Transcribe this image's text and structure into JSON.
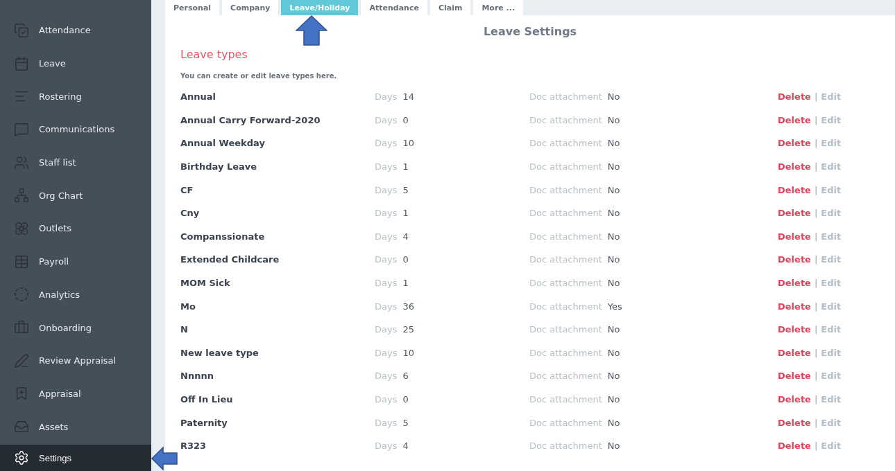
{
  "sidebar": {
    "items": [
      {
        "label": "Attendance",
        "selected": false
      },
      {
        "label": "Leave",
        "selected": false
      },
      {
        "label": "Rostering",
        "selected": false
      },
      {
        "label": "Communications",
        "selected": false
      },
      {
        "label": "Staff list",
        "selected": false
      },
      {
        "label": "Org Chart",
        "selected": false
      },
      {
        "label": "Outlets",
        "selected": false
      },
      {
        "label": "Payroll",
        "selected": false
      },
      {
        "label": "Analytics",
        "selected": false
      },
      {
        "label": "Onboarding",
        "selected": false
      },
      {
        "label": "Review Appraisal",
        "selected": false
      },
      {
        "label": "Appraisal",
        "selected": false
      },
      {
        "label": "Assets",
        "selected": false
      },
      {
        "label": "Settings",
        "selected": true
      }
    ]
  },
  "tabs": [
    {
      "label": "Personal",
      "selected": false
    },
    {
      "label": "Company",
      "selected": false
    },
    {
      "label": "Leave/Holiday",
      "selected": true
    },
    {
      "label": "Attendance",
      "selected": false
    },
    {
      "label": "Claim",
      "selected": false
    },
    {
      "label": "More ...",
      "selected": false
    }
  ],
  "page_title": "Leave Settings",
  "section_title": "Leave types",
  "section_hint": "You can create or edit leave types here.",
  "leave_types": [
    {
      "name": "Annual",
      "days_label": "Days",
      "days": "14",
      "doc_label": "Doc attachment",
      "doc": "No",
      "delete": "Delete",
      "separator": "|",
      "edit": "Edit"
    },
    {
      "name": "Annual Carry Forward-2020",
      "days_label": "Days",
      "days": "0",
      "doc_label": "Doc attachment",
      "doc": "No",
      "delete": "Delete",
      "separator": "|",
      "edit": "Edit"
    },
    {
      "name": "Annual Weekday",
      "days_label": "Days",
      "days": "10",
      "doc_label": "Doc attachment",
      "doc": "No",
      "delete": "Delete",
      "separator": "|",
      "edit": "Edit"
    },
    {
      "name": "Birthday Leave",
      "days_label": "Days",
      "days": "1",
      "doc_label": "Doc attachment",
      "doc": "No",
      "delete": "Delete",
      "separator": "|",
      "edit": "Edit"
    },
    {
      "name": "CF",
      "days_label": "Days",
      "days": "5",
      "doc_label": "Doc attachment",
      "doc": "No",
      "delete": "Delete",
      "separator": "|",
      "edit": "Edit"
    },
    {
      "name": "Cny",
      "days_label": "Days",
      "days": "1",
      "doc_label": "Doc attachment",
      "doc": "No",
      "delete": "Delete",
      "separator": "|",
      "edit": "Edit"
    },
    {
      "name": "Companssionate",
      "days_label": "Days",
      "days": "4",
      "doc_label": "Doc attachment",
      "doc": "No",
      "delete": "Delete",
      "separator": "|",
      "edit": "Edit"
    },
    {
      "name": "Extended Childcare",
      "days_label": "Days",
      "days": "0",
      "doc_label": "Doc attachment",
      "doc": "No",
      "delete": "Delete",
      "separator": "|",
      "edit": "Edit"
    },
    {
      "name": "MOM Sick",
      "days_label": "Days",
      "days": "1",
      "doc_label": "Doc attachment",
      "doc": "No",
      "delete": "Delete",
      "separator": "|",
      "edit": "Edit"
    },
    {
      "name": "Mo",
      "days_label": "Days",
      "days": "36",
      "doc_label": "Doc attachment",
      "doc": "Yes",
      "delete": "Delete",
      "separator": "|",
      "edit": "Edit"
    },
    {
      "name": "N",
      "days_label": "Days",
      "days": "25",
      "doc_label": "Doc attachment",
      "doc": "No",
      "delete": "Delete",
      "separator": "|",
      "edit": "Edit"
    },
    {
      "name": "New leave type",
      "days_label": "Days",
      "days": "10",
      "doc_label": "Doc attachment",
      "doc": "No",
      "delete": "Delete",
      "separator": "|",
      "edit": "Edit"
    },
    {
      "name": "Nnnnn",
      "days_label": "Days",
      "days": "6",
      "doc_label": "Doc attachment",
      "doc": "No",
      "delete": "Delete",
      "separator": "|",
      "edit": "Edit"
    },
    {
      "name": "Off In Lieu",
      "days_label": "Days",
      "days": "0",
      "doc_label": "Doc attachment",
      "doc": "No",
      "delete": "Delete",
      "separator": "|",
      "edit": "Edit"
    },
    {
      "name": "Paternity",
      "days_label": "Days",
      "days": "5",
      "doc_label": "Doc attachment",
      "doc": "No",
      "delete": "Delete",
      "separator": "|",
      "edit": "Edit"
    },
    {
      "name": "R323",
      "days_label": "Days",
      "days": "4",
      "doc_label": "Doc attachment",
      "doc": "No",
      "delete": "Delete",
      "separator": "|",
      "edit": "Edit"
    }
  ]
}
